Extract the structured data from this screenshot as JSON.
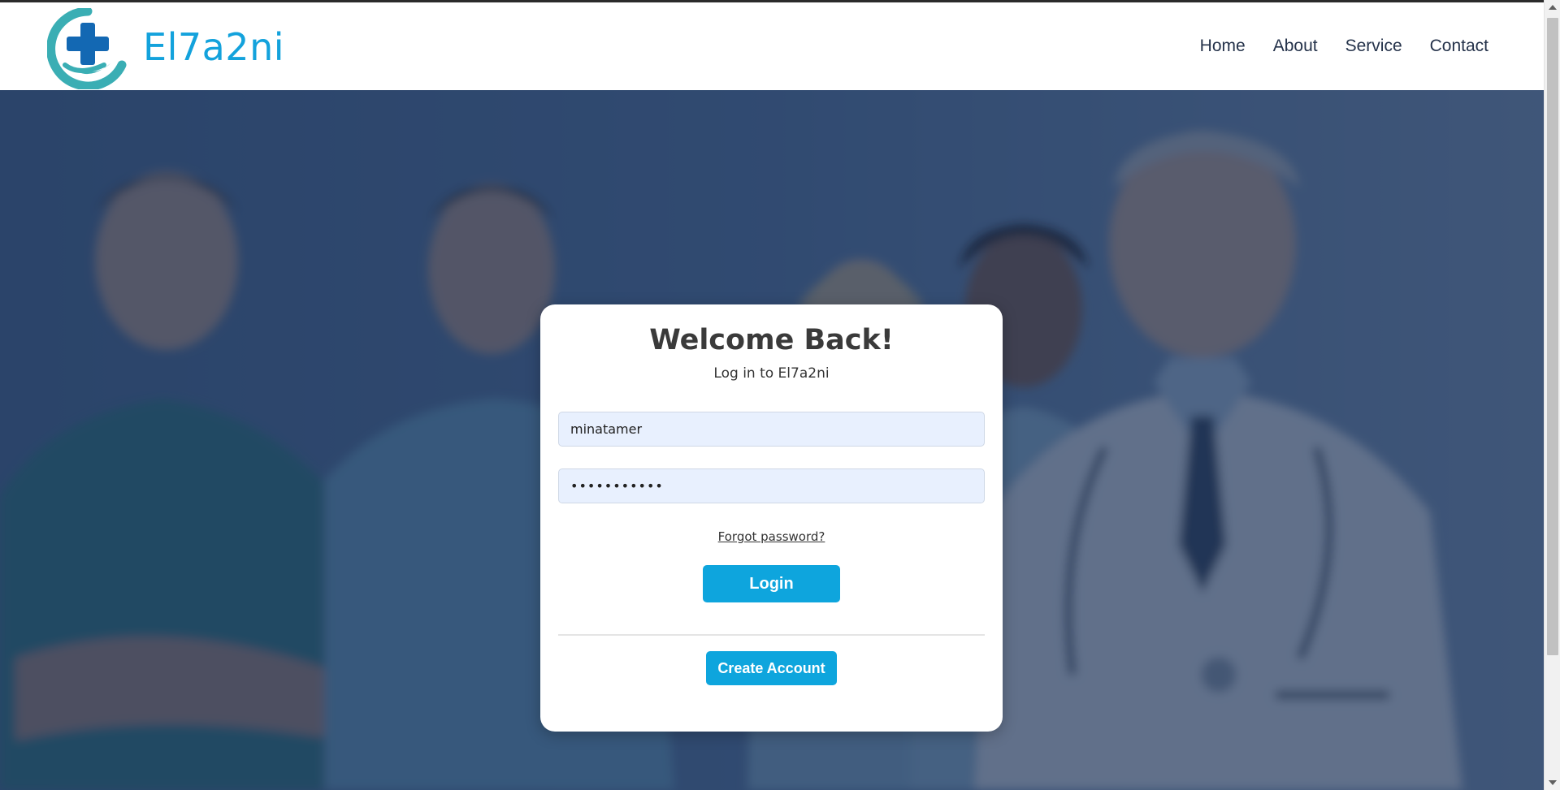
{
  "brand": {
    "name": "El7a2ni"
  },
  "nav": {
    "items": [
      {
        "label": "Home"
      },
      {
        "label": "About"
      },
      {
        "label": "Service"
      },
      {
        "label": "Contact"
      }
    ]
  },
  "login": {
    "title": "Welcome Back!",
    "subtitle": "Log in to El7a2ni",
    "username_value": "minatamer",
    "password_value": "minatamer12",
    "forgot_label": "Forgot password?",
    "login_label": "Login",
    "create_label": "Create Account"
  },
  "colors": {
    "accent": "#0ea5dd",
    "brand_text": "#13a2dc",
    "overlay": "#2b4263",
    "field_bg": "#e8f0fe"
  },
  "icons": {
    "logo": "medical-cross-hand-logo-icon",
    "scroll_up": "chevron-up-icon",
    "scroll_down": "chevron-down-icon"
  }
}
